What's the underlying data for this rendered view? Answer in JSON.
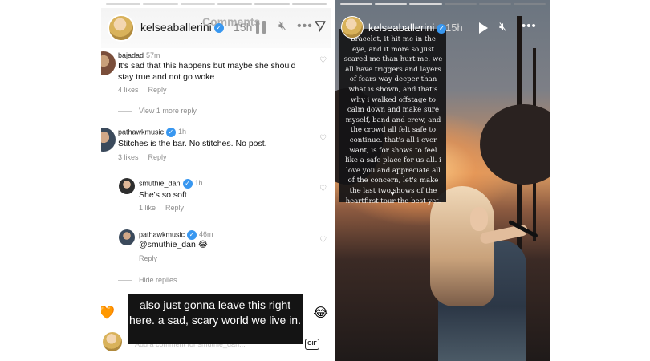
{
  "left_story": {
    "username": "kelseaballerini",
    "overlay_title": "Comments",
    "time": "15h",
    "icons": {
      "pause": "pause-icon",
      "mute": "mute-icon",
      "more": "more-options-icon",
      "send": "send-icon"
    },
    "comments": [
      {
        "user": "bajadad",
        "time": "57m",
        "text": "It's sad that this happens but maybe she should stay true and not go woke",
        "likes": "4 likes",
        "reply": "Reply",
        "thread": "View 1 more reply"
      },
      {
        "user": "pathawkmusic",
        "time": "1h",
        "verified": true,
        "text": "Stitches is the bar. No stitches. No post.",
        "likes": "3 likes",
        "reply": "Reply"
      },
      {
        "user": "smuthie_dan",
        "time": "1h",
        "verified": true,
        "text": "She's so soft",
        "likes": "1 like",
        "reply": "Reply"
      },
      {
        "user": "pathawkmusic",
        "time": "46m",
        "verified": true,
        "text": "@smuthie_dan 😂",
        "likes": "",
        "reply": "Reply",
        "thread": "Hide replies"
      }
    ],
    "caption": "also just gonna leave this right here. a sad, scary world we live in.",
    "comment_placeholder": "Add a comment for smuthie_dan...",
    "gif_label": "GIF",
    "emoji_left": "🧡",
    "emoji_right": "😂"
  },
  "right_story": {
    "username": "kelseaballerini",
    "time": "15h",
    "icons": {
      "play": "play-icon",
      "mute": "mute-icon",
      "more": "more-options-icon"
    },
    "statement": "bracelet, it hit me in the eye, and it more so just scared me than hurt me. we all have triggers and layers of fears way deeper than what is shown, and that's why i walked offstage to calm down and make sure myself, band and crew, and the crowd all felt safe to continue. that's all i ever want, is for shows to feel like a safe place for us all. i love you and appreciate all of the concern, let's make the last two shows of the heartfirst tour the best yet.",
    "heart": "♥"
  },
  "colors": {
    "verified": "#3897f0",
    "caption_bg": "#141414",
    "text_card_bg": "#141416"
  }
}
